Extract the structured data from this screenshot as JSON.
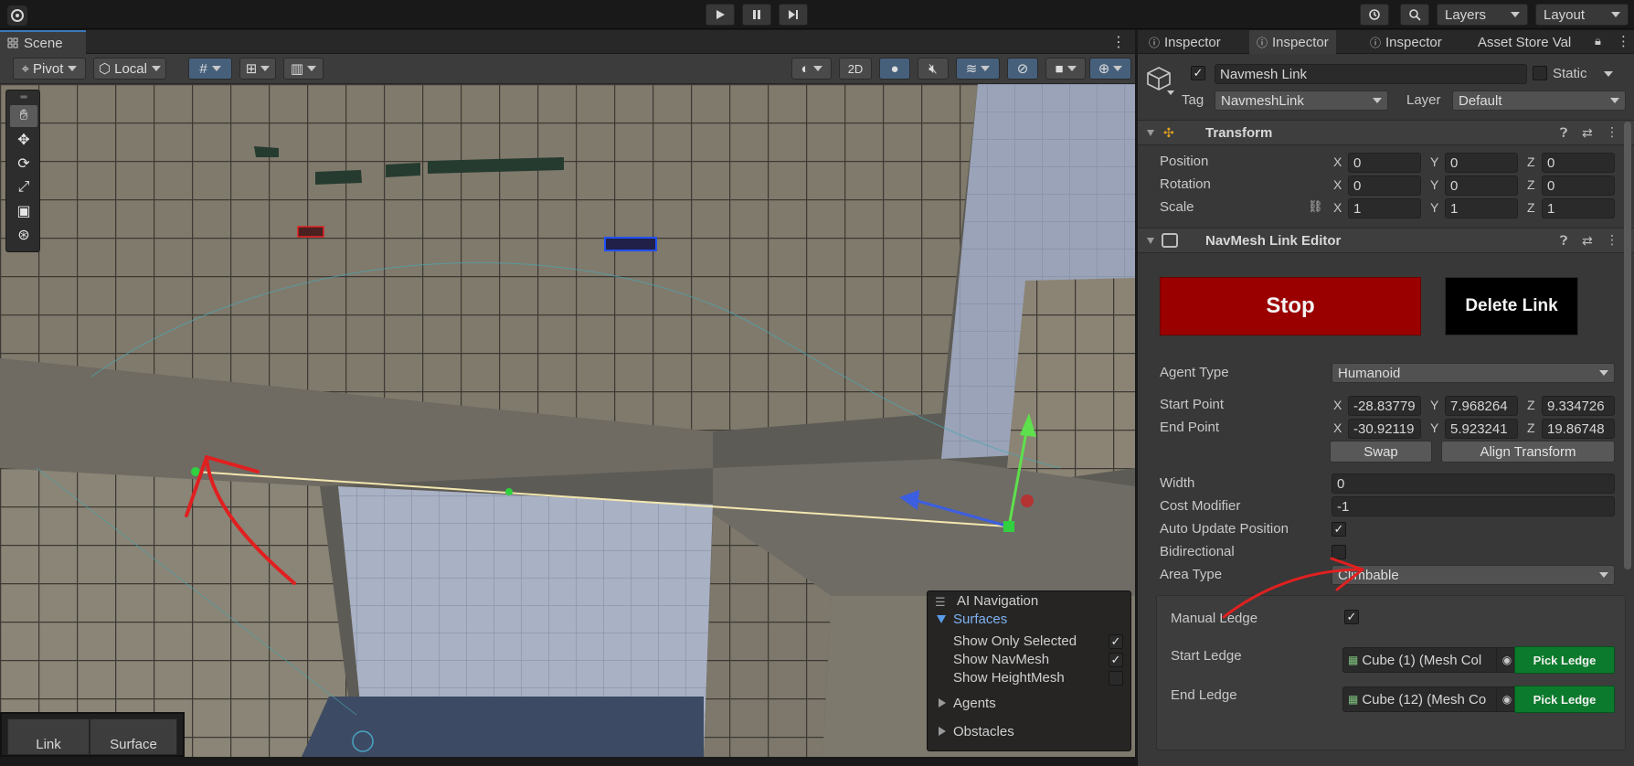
{
  "toolbar": {
    "layers_label": "Layers",
    "layout_label": "Layout"
  },
  "scene": {
    "tab_label": "Scene",
    "pivot_label": "Pivot",
    "local_label": "Local",
    "mode_2d_label": "2D"
  },
  "ai_navigation": {
    "title": "AI Navigation",
    "surfaces_label": "Surfaces",
    "show_only_selected": "Show Only Selected",
    "show_navmesh": "Show NavMesh",
    "show_heightmesh": "Show HeightMesh",
    "agents_label": "Agents",
    "obstacles_label": "Obstacles"
  },
  "bottom_tabs": {
    "link_label": "Link",
    "surface_label": "Surface"
  },
  "inspector": {
    "tabs": [
      "Inspector",
      "Inspector",
      "Inspector",
      "Asset Store Val"
    ],
    "object_name": "Navmesh Link",
    "static_label": "Static",
    "tag_label": "Tag",
    "tag_value": "NavmeshLink",
    "layer_label": "Layer",
    "layer_value": "Default",
    "transform": {
      "title": "Transform",
      "position_label": "Position",
      "rotation_label": "Rotation",
      "scale_label": "Scale",
      "position": {
        "x": "0",
        "y": "0",
        "z": "0"
      },
      "rotation": {
        "x": "0",
        "y": "0",
        "z": "0"
      },
      "scale": {
        "x": "1",
        "y": "1",
        "z": "1"
      }
    },
    "link_editor": {
      "title": "NavMesh Link Editor",
      "stop_label": "Stop",
      "delete_label": "Delete Link",
      "agent_type_label": "Agent Type",
      "agent_type_value": "Humanoid",
      "start_point_label": "Start Point",
      "end_point_label": "End Point",
      "start_point": {
        "x": "-28.83779",
        "y": "7.968264",
        "z": "9.334726"
      },
      "end_point": {
        "x": "-30.92119",
        "y": "5.923241",
        "z": "19.86748"
      },
      "swap_label": "Swap",
      "align_label": "Align Transform",
      "width_label": "Width",
      "width_value": "0",
      "cost_label": "Cost Modifier",
      "cost_value": "-1",
      "auto_update_label": "Auto Update Position",
      "bidirectional_label": "Bidirectional",
      "area_type_label": "Area Type",
      "area_type_value": "Climbable",
      "manual_ledge_label": "Manual Ledge",
      "start_ledge_label": "Start Ledge",
      "start_ledge_value": "Cube (1) (Mesh Col",
      "end_ledge_label": "End Ledge",
      "end_ledge_value": "Cube (12) (Mesh Co",
      "pick_ledge_label": "Pick Ledge"
    },
    "axis_labels": {
      "x": "X",
      "y": "Y",
      "z": "Z"
    }
  },
  "colors": {
    "stop_button": "#9b0000",
    "pick_ledge": "#0c7a2c",
    "annotation_arrow": "#e02020"
  }
}
